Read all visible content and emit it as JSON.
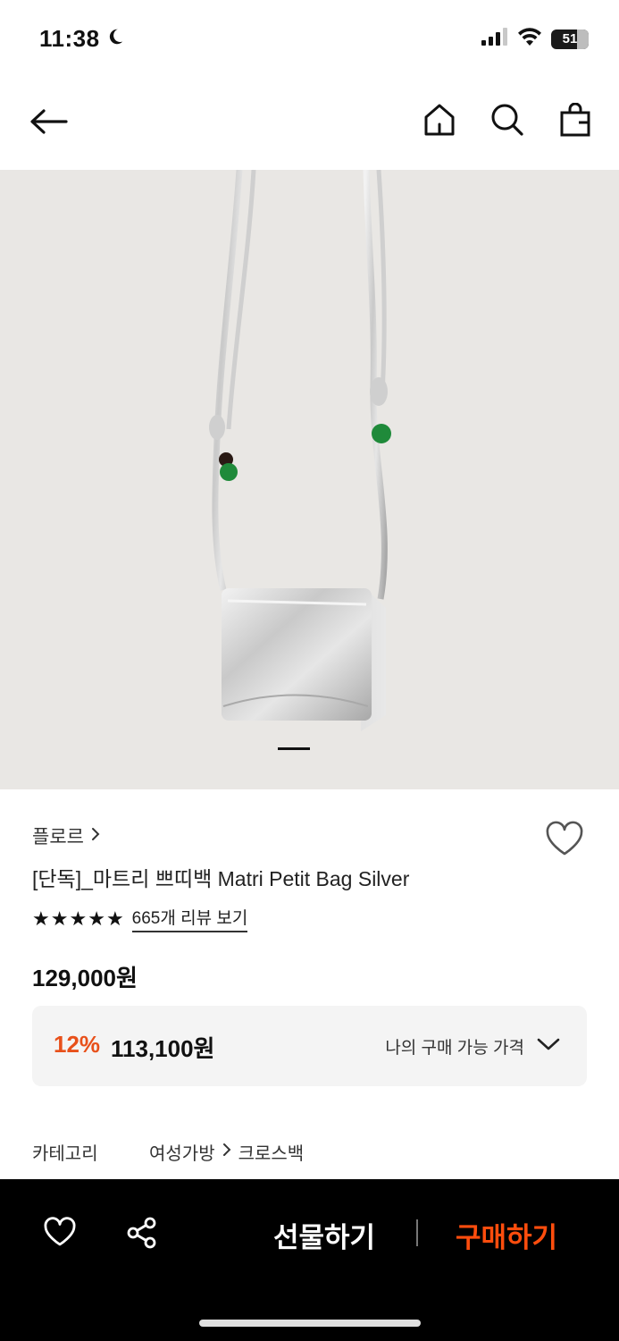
{
  "status_bar": {
    "time": "11:38",
    "battery": "51"
  },
  "product": {
    "brand": "플로르",
    "title": "[단독]_마트리 쁘띠백 Matri Petit Bag Silver",
    "rating_stars": 5,
    "review_link": "665개 리뷰 보기",
    "price": "129,000원",
    "discount_rate": "12%",
    "discount_price": "113,100원",
    "my_price_label": "나의 구매 가능 가격"
  },
  "category": {
    "label": "카테고리",
    "path": [
      "여성가방",
      "크로스백"
    ]
  },
  "bottom_bar": {
    "gift_label": "선물하기",
    "buy_label": "구매하기"
  },
  "colors": {
    "accent": "#e8501a",
    "buy": "#ff4d0d",
    "image_bg": "#e9e7e4"
  },
  "icons": [
    "moon-icon",
    "signal-icon",
    "wifi-icon",
    "battery-icon",
    "back-arrow-icon",
    "home-icon",
    "search-icon",
    "shopping-bag-icon",
    "chevron-right-icon",
    "heart-icon",
    "star-icon",
    "chevron-down-icon",
    "share-icon"
  ]
}
